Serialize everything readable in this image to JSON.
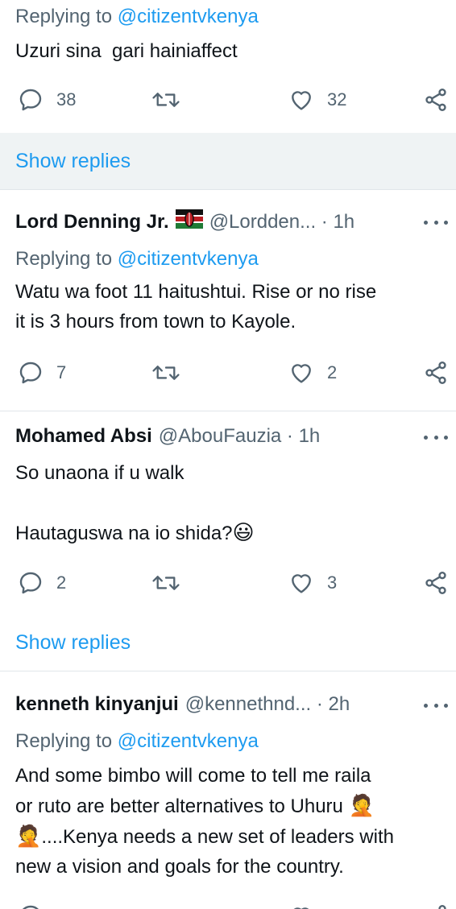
{
  "tweets": [
    {
      "replying_label": "Replying to",
      "replying_handle": "@citizentvkenya",
      "text": "Uzuri sina  gari hainiaffect",
      "replies": "38",
      "likes": "32",
      "show_replies": "Show replies"
    },
    {
      "name": "Lord Denning Jr.",
      "handle_time": "@Lordden... · 1h",
      "replying_label": "Replying to",
      "replying_handle": "@citizentvkenya",
      "text_line1": "Watu wa foot 11 haitushtui. Rise or no rise",
      "text_line2": "it is 3 hours from town to Kayole.",
      "replies": "7",
      "likes": "2"
    },
    {
      "name": "Mohamed Absi",
      "handle_time": "@AbouFauzia · 1h",
      "text_line1": "So unaona if u walk",
      "text_line2": "Hautaguswa na io shida?",
      "emoji": "😃",
      "replies": "2",
      "likes": "3",
      "show_replies": "Show replies"
    },
    {
      "name": "kenneth kinyanjui",
      "handle_time": "@kennethnd... · 2h",
      "replying_label": "Replying to",
      "replying_handle": "@citizentvkenya",
      "text_line1": "And some bimbo will come to tell me raila",
      "text_line2": "or ruto are better alternatives to Uhuru",
      "text_line3": "....Kenya needs a new set of leaders with",
      "text_line4": "new a vision and goals for the country.",
      "emoji": "🤦"
    }
  ],
  "colors": {
    "link": "#1d9bf0",
    "muted": "#536471",
    "divider": "#e1e6ea",
    "highlight": "#eff3f4"
  }
}
